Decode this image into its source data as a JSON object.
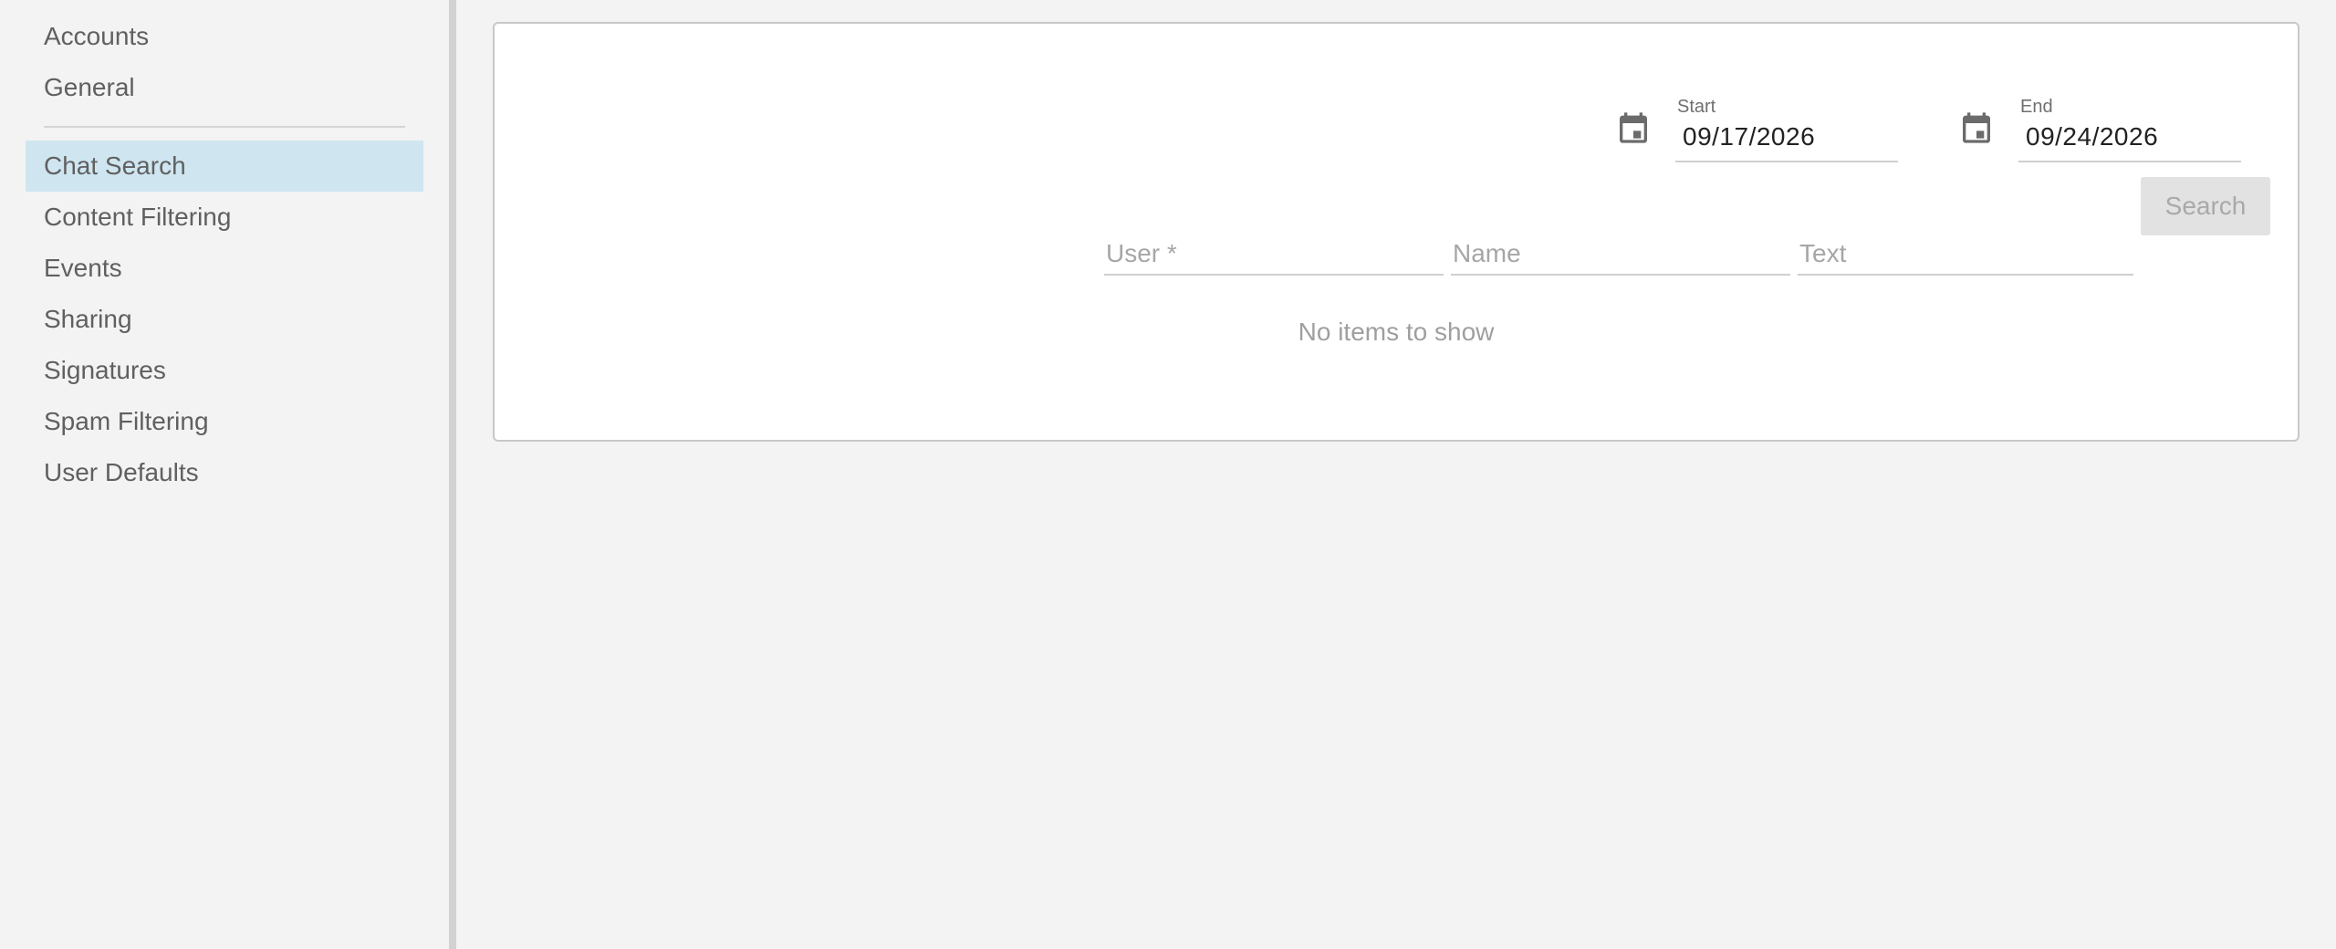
{
  "sidebar": {
    "items_top": [
      {
        "label": "Accounts"
      },
      {
        "label": "General"
      }
    ],
    "items": [
      {
        "label": "Chat Search",
        "active": true
      },
      {
        "label": "Content Filtering"
      },
      {
        "label": "Events"
      },
      {
        "label": "Sharing"
      },
      {
        "label": "Signatures"
      },
      {
        "label": "Spam Filtering"
      },
      {
        "label": "User Defaults"
      }
    ]
  },
  "search": {
    "start_label": "Start",
    "start_value": "09/17/2026",
    "end_label": "End",
    "end_value": "09/24/2026",
    "user_placeholder": "User *",
    "name_placeholder": "Name",
    "text_placeholder": "Text",
    "button_label": "Search",
    "empty_message": "No items to show",
    "calendar_icon": "calendar-icon"
  },
  "colors": {
    "active_item_bg": "#cfe6f1",
    "panel_bg": "#ffffff",
    "page_bg": "#f3f3f3"
  }
}
